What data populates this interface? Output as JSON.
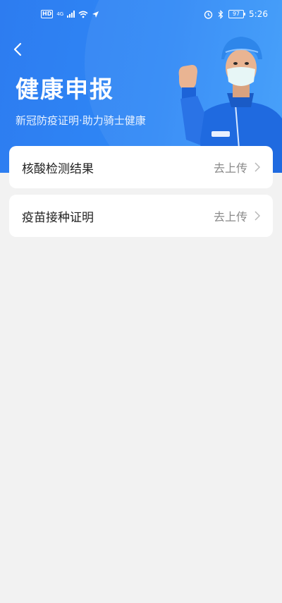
{
  "status_bar": {
    "hd": "HD",
    "network": "4G",
    "time": "5:26",
    "battery": "97"
  },
  "header": {
    "title": "健康申报",
    "subtitle": "新冠防疫证明·助力骑士健康",
    "gradient_start": "#2d7cf0",
    "gradient_end": "#3d9bfa"
  },
  "items": [
    {
      "label": "核酸检测结果",
      "action": "去上传"
    },
    {
      "label": "疫苗接种证明",
      "action": "去上传"
    }
  ],
  "colors": {
    "page_bg": "#f2f2f2",
    "card_bg": "#ffffff",
    "action_text": "#8a8a8a"
  }
}
